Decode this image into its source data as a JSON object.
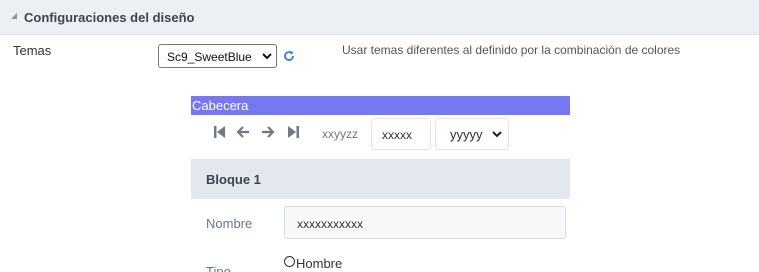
{
  "section": {
    "title": "Configuraciones del diseño"
  },
  "theme_field": {
    "label": "Temas",
    "selected": "Sc9_SweetBlue",
    "help": "Usar temas diferentes al definido por la combinación de colores"
  },
  "preview": {
    "header_title": "Cabecera",
    "toolbar": {
      "text": "xxyyzz",
      "input_value": "xxxxx",
      "select_value": "yyyyy"
    },
    "block_title": "Bloque 1",
    "fields": [
      {
        "label": "Nombre",
        "value": "xxxxxxxxxxx"
      },
      {
        "label": "Tipo",
        "option": "Hombre"
      }
    ]
  },
  "icons": [
    "collapse-triangle-icon",
    "chevron-down-icon",
    "refresh-icon",
    "first-page-icon",
    "arrow-left-icon",
    "arrow-right-icon",
    "last-page-icon"
  ]
}
